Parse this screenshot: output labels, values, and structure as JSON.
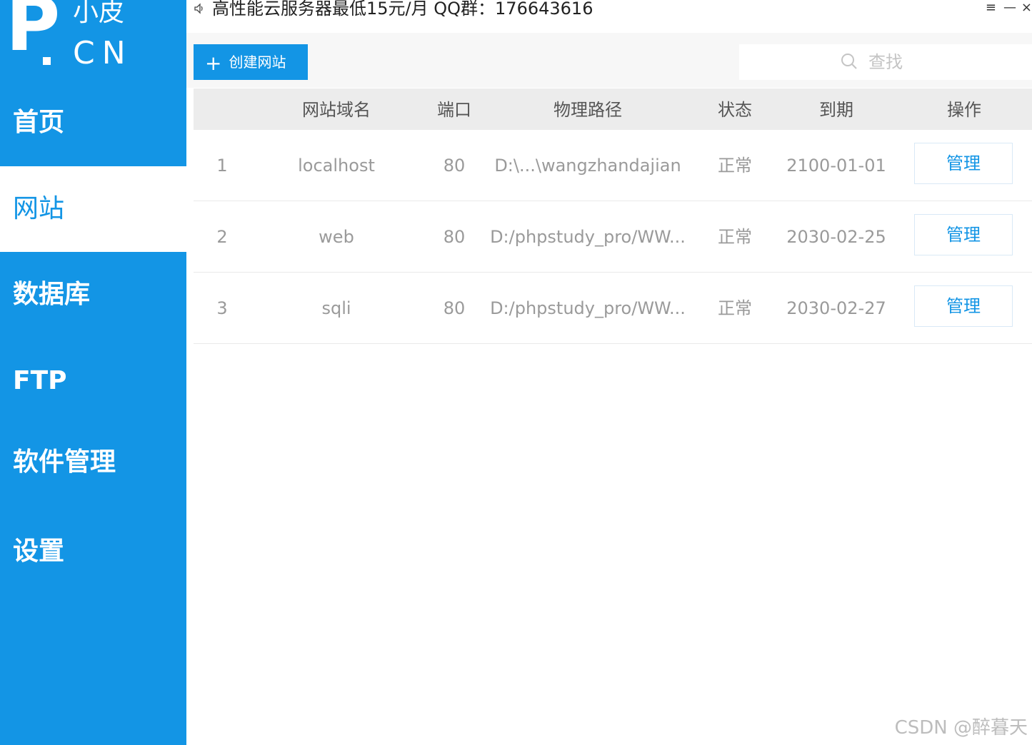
{
  "logo": {
    "letter": "P",
    "top_text": "小皮",
    "bottom_text": "CN"
  },
  "sidebar": {
    "items": [
      {
        "label": "首页",
        "active": false
      },
      {
        "label": "网站",
        "active": true
      },
      {
        "label": "数据库",
        "active": false
      },
      {
        "label": "FTP",
        "active": false
      },
      {
        "label": "软件管理",
        "active": false
      },
      {
        "label": "设置",
        "active": false
      }
    ]
  },
  "topbar": {
    "notice": "高性能云服务器最低15元/月  QQ群：176643616",
    "menu_icon": "≡",
    "minimize_icon": "—",
    "close_icon": "×"
  },
  "toolbar": {
    "create_label": "创建网站",
    "search_placeholder": "查找"
  },
  "table": {
    "headers": [
      "",
      "网站域名",
      "端口",
      "物理路径",
      "状态",
      "到期",
      "操作"
    ],
    "rows": [
      {
        "index": "1",
        "domain": "localhost",
        "port": "80",
        "path": "D:\\...\\wangzhandajian",
        "status": "正常",
        "expires": "2100-01-01",
        "action": "管理"
      },
      {
        "index": "2",
        "domain": "web",
        "port": "80",
        "path": "D:/phpstudy_pro/WW...",
        "status": "正常",
        "expires": "2030-02-25",
        "action": "管理"
      },
      {
        "index": "3",
        "domain": "sqli",
        "port": "80",
        "path": "D:/phpstudy_pro/WW...",
        "status": "正常",
        "expires": "2030-02-27",
        "action": "管理"
      }
    ]
  },
  "watermark": "CSDN @醉暮天",
  "colors": {
    "accent": "#1395e5",
    "header_bg": "#ececec",
    "toolbar_bg": "#f7f7f7"
  }
}
